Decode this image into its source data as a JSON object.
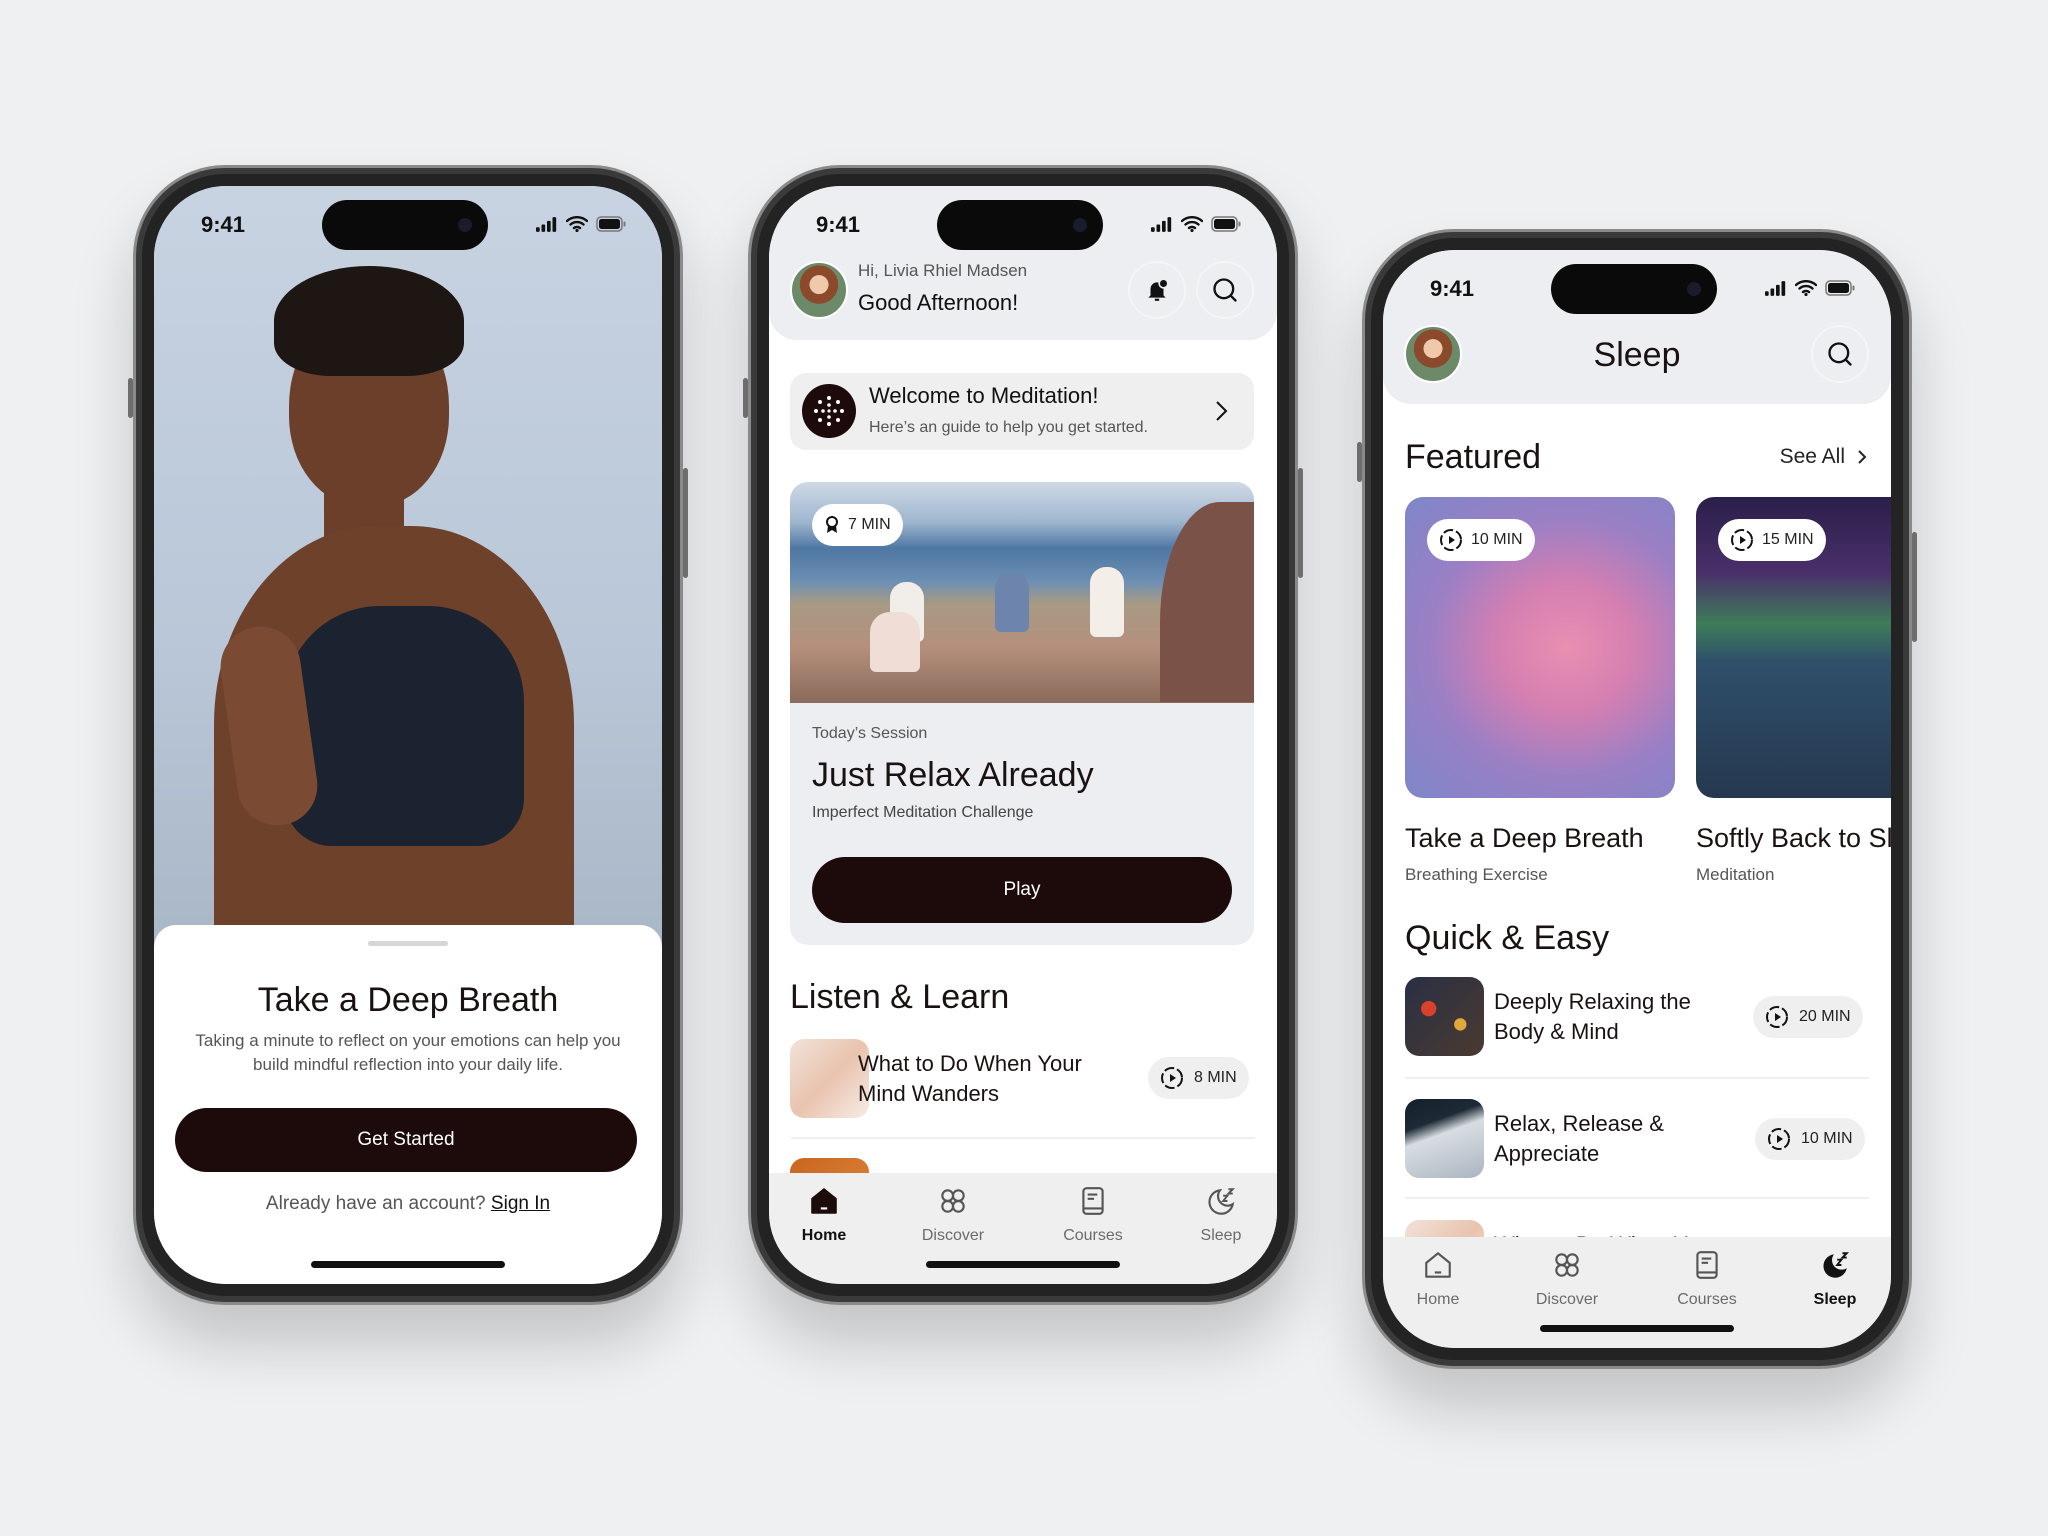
{
  "colors": {
    "background": "#eff0f2",
    "primary_button": "#1d0b0b",
    "header_bg": "#eceef1",
    "pill_bg": "#efefef"
  },
  "phone1": {
    "status_time": "9:41",
    "title": "Take a Deep Breath",
    "description": "Taking a minute to reflect on your emotions can help you build mindful reflection into your daily life.",
    "cta": "Get Started",
    "account_prompt": "Already have an account?",
    "sign_in": "Sign In"
  },
  "phone2": {
    "status_time": "9:41",
    "greeting_name": "Hi, Livia Rhiel Madsen",
    "greeting": "Good Afternoon!",
    "welcome": {
      "title": "Welcome to Meditation!",
      "subtitle": "Here’s an guide to help you get started."
    },
    "session": {
      "badge": "7 MIN",
      "label": "Today’s Session",
      "title": "Just Relax Already",
      "subtitle": "Imperfect Meditation Challenge",
      "play": "Play"
    },
    "section_title": "Listen & Learn",
    "items": [
      {
        "title": "What to Do When Your Mind Wanders",
        "duration": "8 MIN"
      }
    ],
    "tabs": [
      {
        "label": "Home",
        "icon": "home-icon",
        "active": true
      },
      {
        "label": "Discover",
        "icon": "discover-icon"
      },
      {
        "label": "Courses",
        "icon": "book-icon"
      },
      {
        "label": "Sleep",
        "icon": "moon-icon"
      }
    ]
  },
  "phone3": {
    "status_time": "9:41",
    "title": "Sleep",
    "featured_title": "Featured",
    "see_all": "See All",
    "cards": [
      {
        "duration": "10 MIN",
        "title": "Take a Deep Breath",
        "subtitle": "Breathing Exercise"
      },
      {
        "duration": "15 MIN",
        "title": "Softly Back to Sleep",
        "subtitle": "Meditation"
      }
    ],
    "quick_title": "Quick & Easy",
    "items": [
      {
        "title": "Deeply Relaxing the Body & Mind",
        "duration": "20 MIN"
      },
      {
        "title": "Relax, Release & Appreciate",
        "duration": "10 MIN"
      },
      {
        "title": "What to Do When Your"
      }
    ],
    "tabs": [
      {
        "label": "Home",
        "icon": "home-icon"
      },
      {
        "label": "Discover",
        "icon": "discover-icon"
      },
      {
        "label": "Courses",
        "icon": "book-icon"
      },
      {
        "label": "Sleep",
        "icon": "moon-icon",
        "active": true
      }
    ]
  }
}
